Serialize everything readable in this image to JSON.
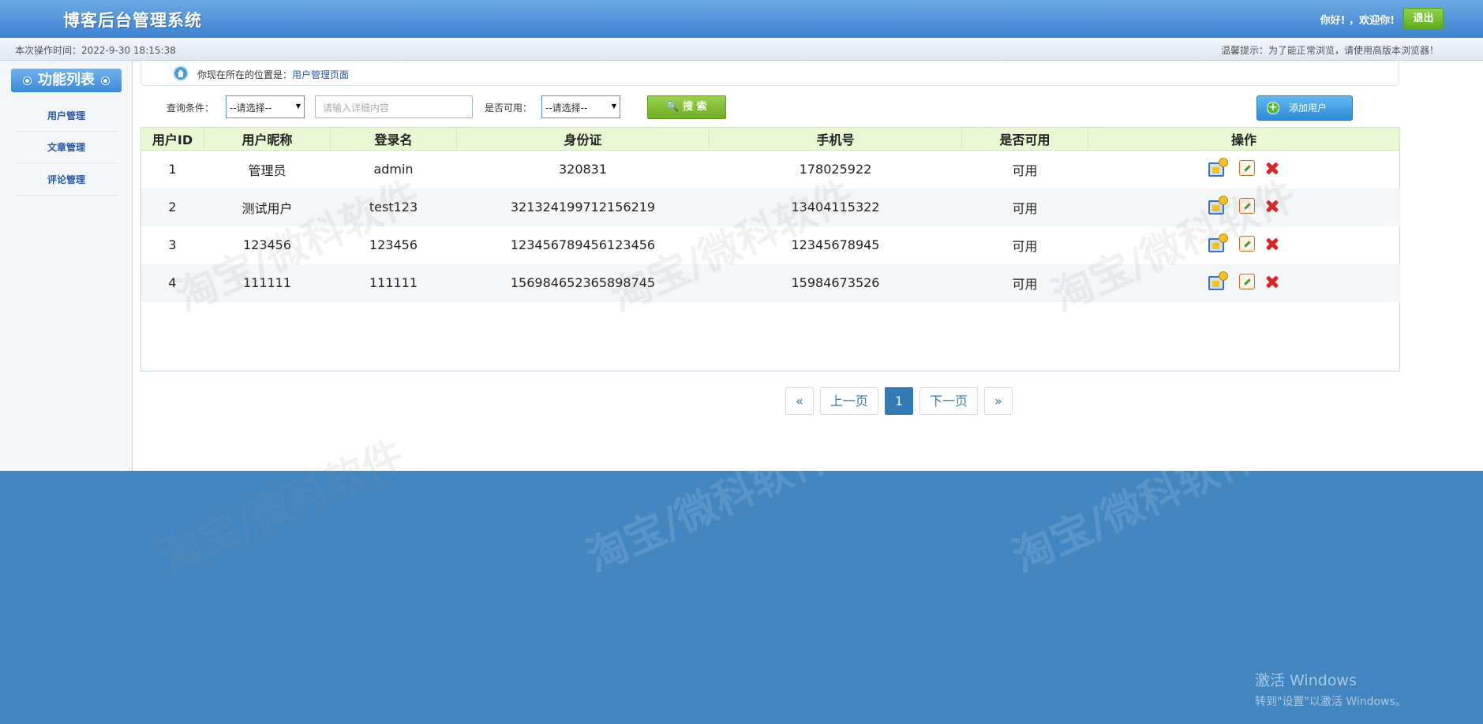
{
  "header": {
    "title": "博客后台管理系统",
    "greeting": "你好! ，欢迎你!",
    "logout_label": "退出"
  },
  "subbar": {
    "time": "本次操作时间：2022-9-30 18:15:38",
    "tip": "温馨提示：为了能正常浏览，请使用高版本浏览器！"
  },
  "sidebar": {
    "title": "功能列表",
    "items": [
      {
        "label": "用户管理"
      },
      {
        "label": "文章管理"
      },
      {
        "label": "评论管理"
      }
    ]
  },
  "breadcrumb": {
    "prefix": "你现在所在的位置是：",
    "current": "用户管理页面"
  },
  "search": {
    "condition_label": "查询条件：",
    "condition_value": "--请选择--",
    "input_placeholder": "请输入详细内容",
    "available_label": "是否可用：",
    "available_value": "--请选择--",
    "search_label": "搜 索",
    "add_label": "添加用户"
  },
  "table": {
    "columns": [
      "用户ID",
      "用户昵称",
      "登录名",
      "身份证",
      "手机号",
      "是否可用",
      "操作"
    ],
    "rows": [
      {
        "id": "1",
        "nickname": "管理员",
        "login": "admin",
        "idcard": "320831",
        "phone": "178025922",
        "available": "可用"
      },
      {
        "id": "2",
        "nickname": "测试用户",
        "login": "test123",
        "idcard": "321324199712156219",
        "phone": "13404115322",
        "available": "可用"
      },
      {
        "id": "3",
        "nickname": "123456",
        "login": "123456",
        "idcard": "123456789456123456",
        "phone": "12345678945",
        "available": "可用"
      },
      {
        "id": "4",
        "nickname": "111111",
        "login": "111111",
        "idcard": "156984652365898745",
        "phone": "15984673526",
        "available": "可用"
      }
    ]
  },
  "pager": {
    "first": "«",
    "prev": "上一页",
    "current": "1",
    "next": "下一页",
    "last": "»"
  },
  "watermark": "淘宝/微科软件",
  "windows": {
    "line1": "激活 Windows",
    "line2": "转到\"设置\"以激活 Windows。"
  },
  "icons": {
    "role": "role-assign-icon",
    "edit": "edit-icon",
    "delete": "delete-icon",
    "home": "home-icon",
    "search": "search-icon",
    "add": "add-icon"
  }
}
